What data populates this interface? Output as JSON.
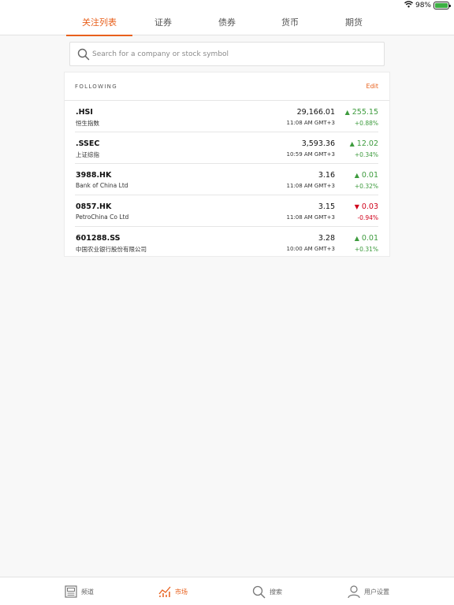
{
  "status_bar": {
    "battery_percent_text": "98%",
    "battery_level": 0.98
  },
  "top_tabs": [
    {
      "label": "关注列表",
      "active": true
    },
    {
      "label": "证券",
      "active": false
    },
    {
      "label": "债券",
      "active": false
    },
    {
      "label": "货币",
      "active": false
    },
    {
      "label": "期货",
      "active": false
    }
  ],
  "search": {
    "placeholder": "Search for a company or stock symbol",
    "value": ""
  },
  "watchlist": {
    "title": "FOLLOWING",
    "edit_label": "Edit",
    "rows": [
      {
        "symbol": ".HSI",
        "name": "恒生指数",
        "price": "29,166.01",
        "time": "11:08 AM GMT+3",
        "change": "255.15",
        "percent": "+0.88%",
        "direction": "up"
      },
      {
        "symbol": ".SSEC",
        "name": "上证综指",
        "price": "3,593.36",
        "time": "10:59 AM GMT+3",
        "change": "12.02",
        "percent": "+0.34%",
        "direction": "up"
      },
      {
        "symbol": "3988.HK",
        "name": "Bank of China Ltd",
        "price": "3.16",
        "time": "11:08 AM GMT+3",
        "change": "0.01",
        "percent": "+0.32%",
        "direction": "up"
      },
      {
        "symbol": "0857.HK",
        "name": "PetroChina Co Ltd",
        "price": "3.15",
        "time": "11:08 AM GMT+3",
        "change": "0.03",
        "percent": "-0.94%",
        "direction": "down"
      },
      {
        "symbol": "601288.SS",
        "name": "中国农业银行股份有限公司",
        "price": "3.28",
        "time": "10:00 AM GMT+3",
        "change": "0.01",
        "percent": "+0.31%",
        "direction": "up"
      }
    ]
  },
  "bottom_tabs": [
    {
      "label": "频道",
      "icon": "channels-icon",
      "active": false
    },
    {
      "label": "市场",
      "icon": "markets-chart-icon",
      "active": true
    },
    {
      "label": "搜索",
      "icon": "search-icon",
      "active": false
    },
    {
      "label": "用户设置",
      "icon": "user-icon",
      "active": false
    }
  ],
  "colors": {
    "accent": "#e8601c",
    "up": "#3d9b3d",
    "down": "#d0021b"
  }
}
